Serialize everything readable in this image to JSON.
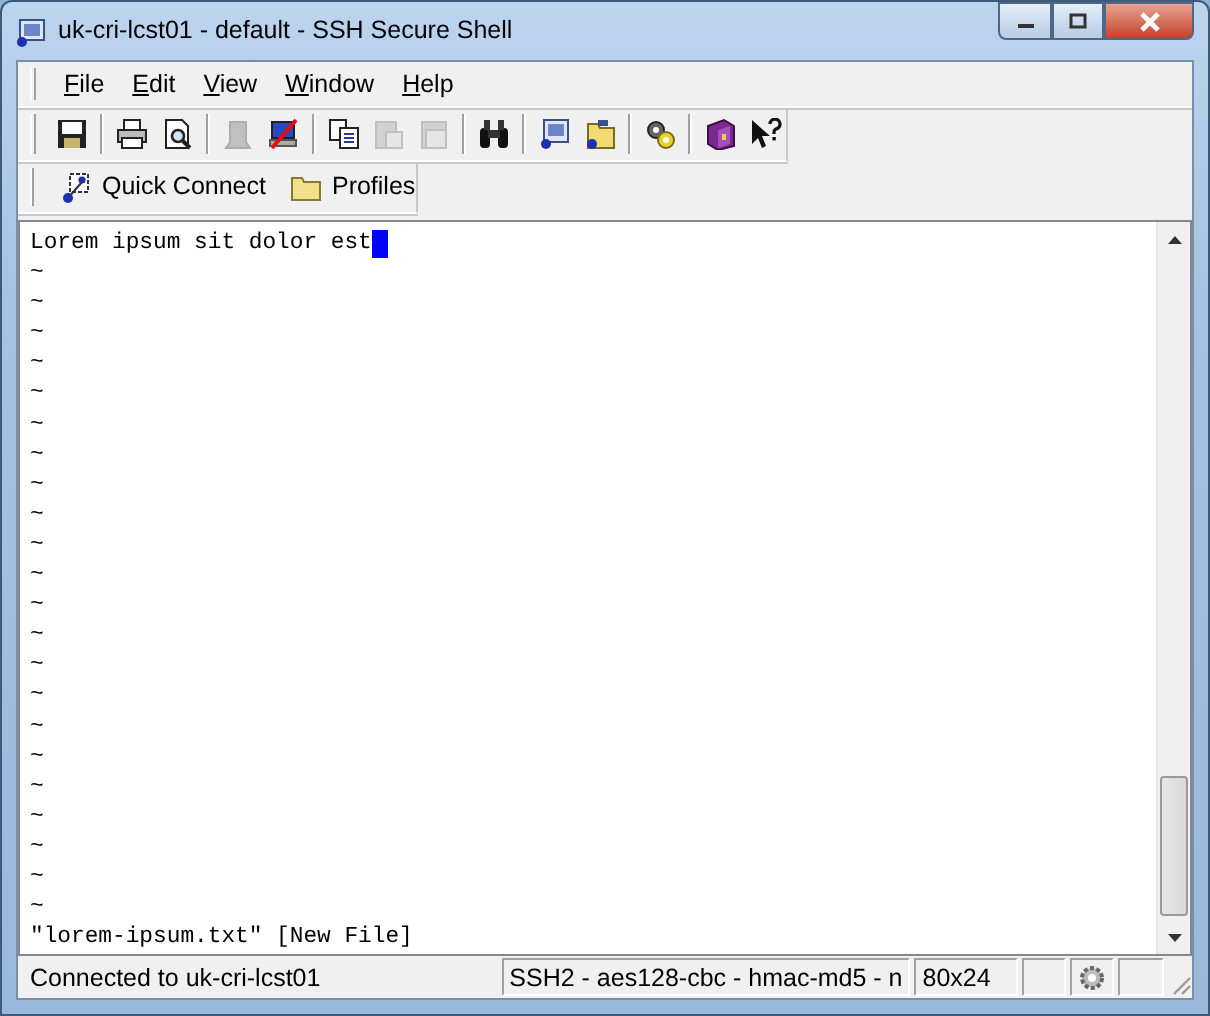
{
  "window": {
    "title": "uk-cri-lcst01 - default - SSH Secure Shell"
  },
  "menu": [
    "File",
    "Edit",
    "View",
    "Window",
    "Help"
  ],
  "toolbar": [
    [
      {
        "kind": "save",
        "disabled": false
      }
    ],
    [
      {
        "kind": "print",
        "disabled": false
      },
      {
        "kind": "preview",
        "disabled": false
      }
    ],
    [
      {
        "kind": "connect",
        "disabled": true
      },
      {
        "kind": "disconnect",
        "disabled": false
      }
    ],
    [
      {
        "kind": "copy",
        "disabled": false
      },
      {
        "kind": "paste",
        "disabled": true
      },
      {
        "kind": "paste-special",
        "disabled": true
      }
    ],
    [
      {
        "kind": "find",
        "disabled": false
      }
    ],
    [
      {
        "kind": "terminal",
        "disabled": false
      },
      {
        "kind": "transfer",
        "disabled": false
      }
    ],
    [
      {
        "kind": "settings",
        "disabled": false
      }
    ],
    [
      {
        "kind": "help",
        "disabled": false
      },
      {
        "kind": "whatsthis",
        "disabled": false
      }
    ]
  ],
  "connect_bar": [
    {
      "kind": "quick",
      "label": "Quick Connect"
    },
    {
      "kind": "folder",
      "label": "Profiles"
    }
  ],
  "terminal": {
    "lines": [
      {
        "text": "Lorem ipsum sit dolor est",
        "cursor": true
      },
      {
        "text": "~",
        "cursor": false
      },
      {
        "text": "~",
        "cursor": false
      },
      {
        "text": "~",
        "cursor": false
      },
      {
        "text": "~",
        "cursor": false
      },
      {
        "text": "~",
        "cursor": false
      },
      {
        "text": "~",
        "cursor": false
      },
      {
        "text": "~",
        "cursor": false
      },
      {
        "text": "~",
        "cursor": false
      },
      {
        "text": "~",
        "cursor": false
      },
      {
        "text": "~",
        "cursor": false
      },
      {
        "text": "~",
        "cursor": false
      },
      {
        "text": "~",
        "cursor": false
      },
      {
        "text": "~",
        "cursor": false
      },
      {
        "text": "~",
        "cursor": false
      },
      {
        "text": "~",
        "cursor": false
      },
      {
        "text": "~",
        "cursor": false
      },
      {
        "text": "~",
        "cursor": false
      },
      {
        "text": "~",
        "cursor": false
      },
      {
        "text": "~",
        "cursor": false
      },
      {
        "text": "~",
        "cursor": false
      },
      {
        "text": "~",
        "cursor": false
      },
      {
        "text": "~",
        "cursor": false
      },
      {
        "text": "\"lorem-ipsum.txt\" [New File]",
        "cursor": false
      }
    ]
  },
  "status_bar": {
    "connection": "Connected to uk-cri-lcst01",
    "cipher": "SSH2 - aes128-cbc - hmac-md5 - n",
    "size": "80x24"
  }
}
